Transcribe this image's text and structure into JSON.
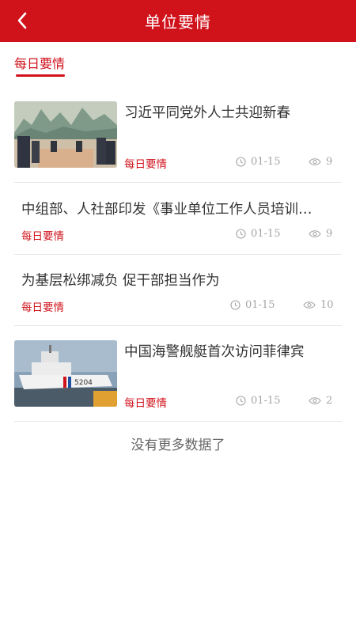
{
  "theme": {
    "primary": "#d0121b",
    "text": "#333333",
    "muted": "#a5a5a5"
  },
  "header": {
    "title": "单位要情",
    "back_icon": "chevron-left-icon"
  },
  "tabs": [
    {
      "label": "每日要情",
      "active": true
    }
  ],
  "articles": [
    {
      "title": "习近平同党外人士共迎新春",
      "category": "每日要情",
      "date": "01-15",
      "views": "9",
      "has_thumbnail": true
    },
    {
      "title": "中组部、人社部印发《事业单位工作人员培训规定》",
      "category": "每日要情",
      "date": "01-15",
      "views": "9",
      "has_thumbnail": false
    },
    {
      "title": "为基层松绑减负 促干部担当作为",
      "category": "每日要情",
      "date": "01-15",
      "views": "10",
      "has_thumbnail": false
    },
    {
      "title": "中国海警舰艇首次访问菲律宾",
      "category": "每日要情",
      "date": "01-15",
      "views": "2",
      "has_thumbnail": true
    }
  ],
  "footer": {
    "no_more": "没有更多数据了"
  }
}
